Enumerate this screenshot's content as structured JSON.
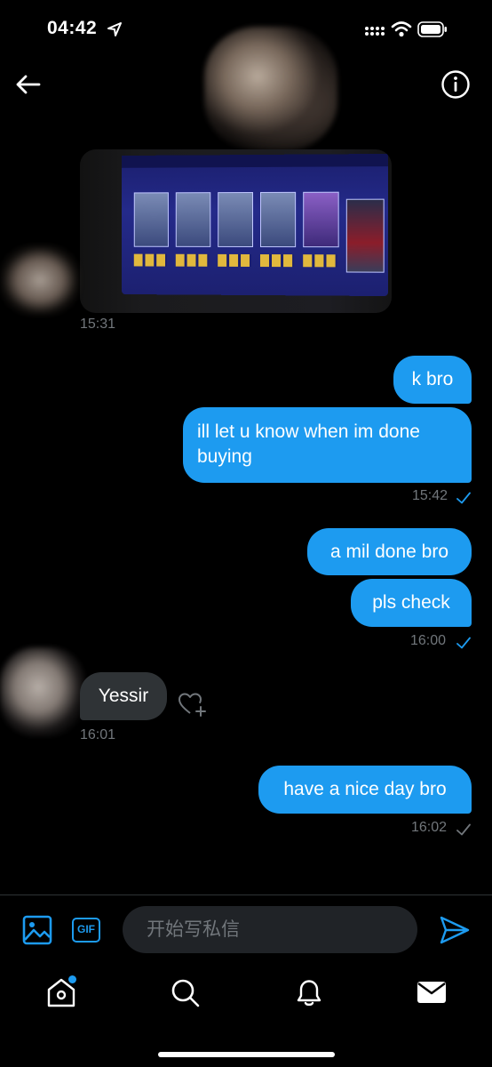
{
  "status_bar": {
    "time": "04:42"
  },
  "messages": [
    {
      "type": "image",
      "direction": "in",
      "time": "15:31"
    },
    {
      "type": "text",
      "direction": "out",
      "text": "k bro"
    },
    {
      "type": "text",
      "direction": "out",
      "text_line1": "ill let u know when im done",
      "text_line2": "buying",
      "time": "15:42"
    },
    {
      "type": "text",
      "direction": "out",
      "text": "a mil done bro"
    },
    {
      "type": "text",
      "direction": "out",
      "text": "pls check",
      "time": "16:00"
    },
    {
      "type": "text",
      "direction": "in",
      "text": "Yessir",
      "time": "16:01"
    },
    {
      "type": "text",
      "direction": "out",
      "text": "have a nice day bro",
      "time": "16:02"
    }
  ],
  "composer": {
    "gif_label": "GIF",
    "placeholder": "开始写私信"
  },
  "icons": {
    "back": "back-arrow-icon",
    "info": "info-icon",
    "image": "image-icon",
    "send": "send-icon",
    "heart_add": "heart-add-icon",
    "nav": [
      "home-icon",
      "search-icon",
      "bell-icon",
      "mail-icon"
    ]
  },
  "colors": {
    "accent": "#1d9bf0",
    "incoming_bubble": "#2f3336",
    "input_bg": "#202327",
    "muted_text": "#71767b"
  }
}
